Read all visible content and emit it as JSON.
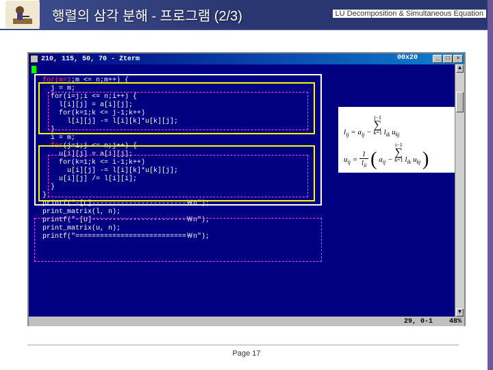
{
  "slide": {
    "title": "행렬의 삼각 분해 - 프로그램 (2/3)",
    "subtitle": "LU Decomposition & Simultaneous Equation",
    "page_label": "Page 17"
  },
  "terminal": {
    "window_title": "210, 115, 50, 70 - Zterm",
    "size_label": "00x20",
    "status_pos": "29, 0-1",
    "status_pct": "48%",
    "code": {
      "l01": "for(m=1;m <= n;m++) {",
      "l02": "  j = m;",
      "l03": "  for(i=j;i <= n;i++) {",
      "l04": "    l[i][j] = a[i][j];",
      "l05": "    for(k=1;k <= j-1;k++)",
      "l06": "      l[i][j] -= l[i][k]*u[k][j];",
      "l07": "  }",
      "l08": "",
      "l09": "  i = m;",
      "l10": "  for(j=i;j <= n;j++) {",
      "l11": "    u[i][j] = a[i][j];",
      "l12": "    for(k=1;k <= i-1;k++)",
      "l13": "      u[i][j] -= l[i][k]*u[k][j];",
      "l14": "    u[i][j] /= l[i][i];",
      "l15": "  }",
      "l16": "}",
      "l17": "",
      "l18": "printf(\"-[L]-----------------------￦n\");",
      "l19": "print_matrix(l, n);",
      "l20": "printf(\"-[U]-----------------------￦n\");",
      "l21": "print_matrix(u, n);",
      "l22": "printf(\"===========================￦n\");"
    }
  },
  "formula": {
    "l_label": "l",
    "l_sub": "ij",
    "eq": " = ",
    "a_label": "a",
    "a_sub": "ij",
    "minus": " − ",
    "sum_top1": "j−1",
    "sum_bot": "k=1",
    "lik": "l",
    "lik_sub": "ik",
    "ukj": "u",
    "ukj_sub": "kj",
    "u_label": "u",
    "u_sub": "ij",
    "one": "1",
    "lii": "l",
    "lii_sub": "ii",
    "sum_top2": "i−1"
  }
}
